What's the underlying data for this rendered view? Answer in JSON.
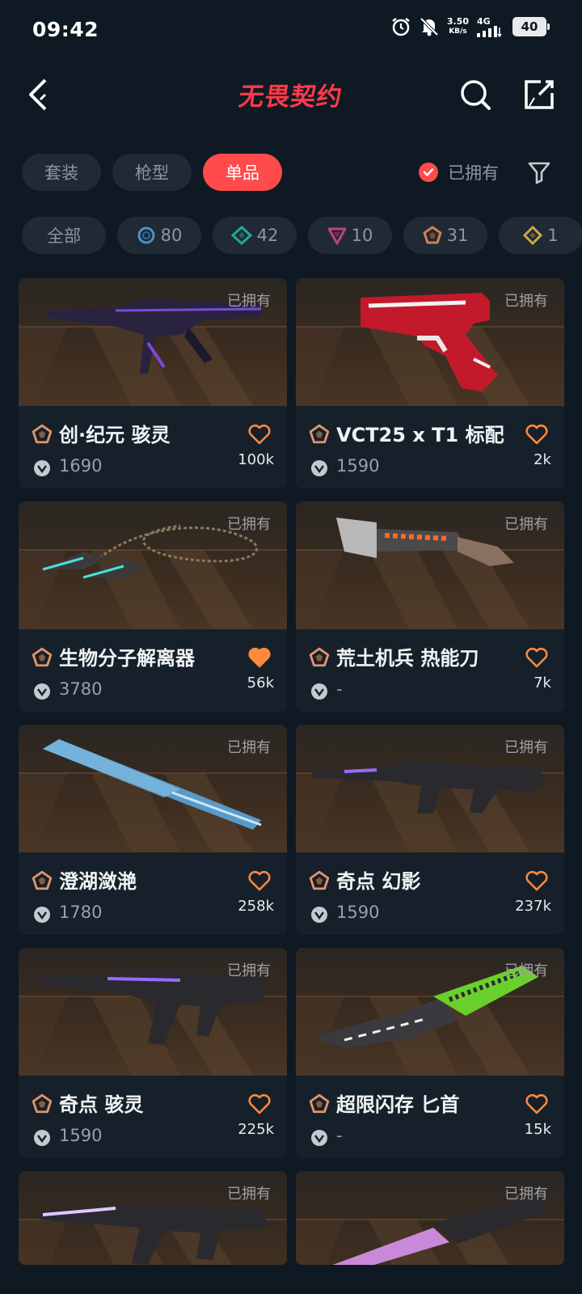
{
  "status_bar": {
    "time": "09:42",
    "net_speed": "3.50",
    "net_unit": "KB/s",
    "net_type": "4G",
    "battery": "40"
  },
  "header": {
    "title": "无畏契约"
  },
  "tabs": [
    {
      "label": "套装",
      "active": false
    },
    {
      "label": "枪型",
      "active": false
    },
    {
      "label": "单品",
      "active": true
    }
  ],
  "owned_filter": {
    "label": "已拥有",
    "checked": true
  },
  "rarity_chips": [
    {
      "count": "",
      "label": "全部",
      "icon": "none"
    },
    {
      "count": "80",
      "icon": "select-edition-icon",
      "color": "#4a90c8"
    },
    {
      "count": "42",
      "icon": "deluxe-edition-icon",
      "color": "#1fa89a"
    },
    {
      "count": "10",
      "icon": "premium-edition-icon",
      "color": "#c0407a"
    },
    {
      "count": "31",
      "icon": "exclusive-edition-icon",
      "color": "#d08050"
    },
    {
      "count": "1",
      "icon": "ultra-edition-icon",
      "color": "#c8a850"
    }
  ],
  "owned_tag": "已拥有",
  "cards": [
    {
      "name": "创·纪元 骇灵",
      "price": "1690",
      "likes": "100k",
      "favorited": false
    },
    {
      "name": "VCT25 x T1 标配",
      "price": "1590",
      "likes": "2k",
      "favorited": false
    },
    {
      "name": "生物分子解离器",
      "price": "3780",
      "likes": "56k",
      "favorited": true
    },
    {
      "name": "荒土机兵 热能刀",
      "price": "-",
      "likes": "7k",
      "favorited": false
    },
    {
      "name": "澄湖潋滟",
      "price": "1780",
      "likes": "258k",
      "favorited": false
    },
    {
      "name": "奇点 幻影",
      "price": "1590",
      "likes": "237k",
      "favorited": false
    },
    {
      "name": "奇点 骇灵",
      "price": "1590",
      "likes": "225k",
      "favorited": false
    },
    {
      "name": "超限闪存 匕首",
      "price": "-",
      "likes": "15k",
      "favorited": false
    }
  ],
  "colors": {
    "background": "#0f1923",
    "accent": "#ff4b4b",
    "rarity_orange": "#e0956a",
    "heart": "#ff8a3d"
  }
}
